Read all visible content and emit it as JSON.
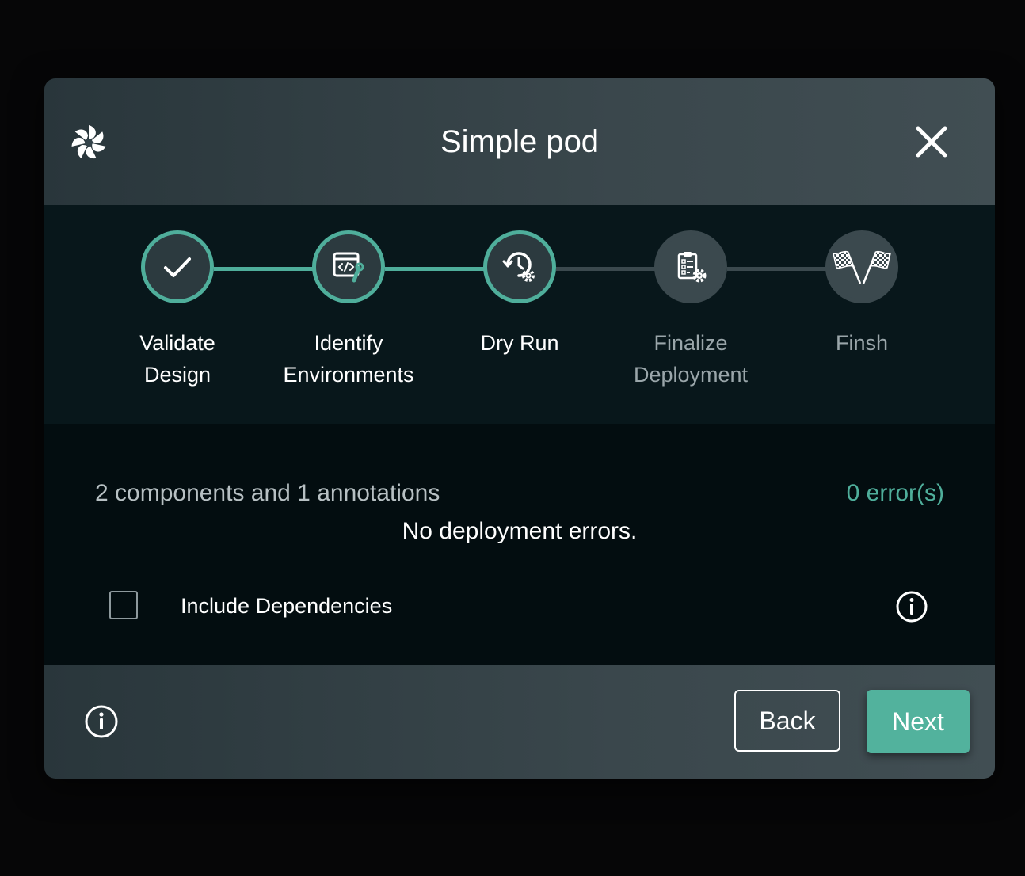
{
  "dialog": {
    "title": "Simple pod"
  },
  "icons": {
    "logo": "meshery-logo-icon",
    "close": "close-icon",
    "info": "info-icon"
  },
  "stepper": {
    "steps": [
      {
        "line1": "Validate",
        "line2": "Design",
        "state": "completed",
        "icon": "checkmark-icon"
      },
      {
        "line1": "Identify",
        "line2": "Environments",
        "state": "completed",
        "icon": "code-wrench-icon"
      },
      {
        "line1": "Dry Run",
        "line2": "",
        "state": "active",
        "icon": "history-gear-icon"
      },
      {
        "line1": "Finalize",
        "line2": "Deployment",
        "state": "pending",
        "icon": "clipboard-gear-icon"
      },
      {
        "line1": "Finsh",
        "line2": "",
        "state": "pending",
        "icon": "checkered-flags-icon"
      }
    ]
  },
  "body": {
    "summary": "2 components and 1 annotations",
    "error_count": "0 error(s)",
    "message": "No deployment errors.",
    "dependencies_label": "Include Dependencies",
    "dependencies_checked": false
  },
  "footer": {
    "back_label": "Back",
    "next_label": "Next"
  },
  "colors": {
    "accent": "#52b29d",
    "step_pending": "#3b494e",
    "backdrop": "#060607"
  }
}
